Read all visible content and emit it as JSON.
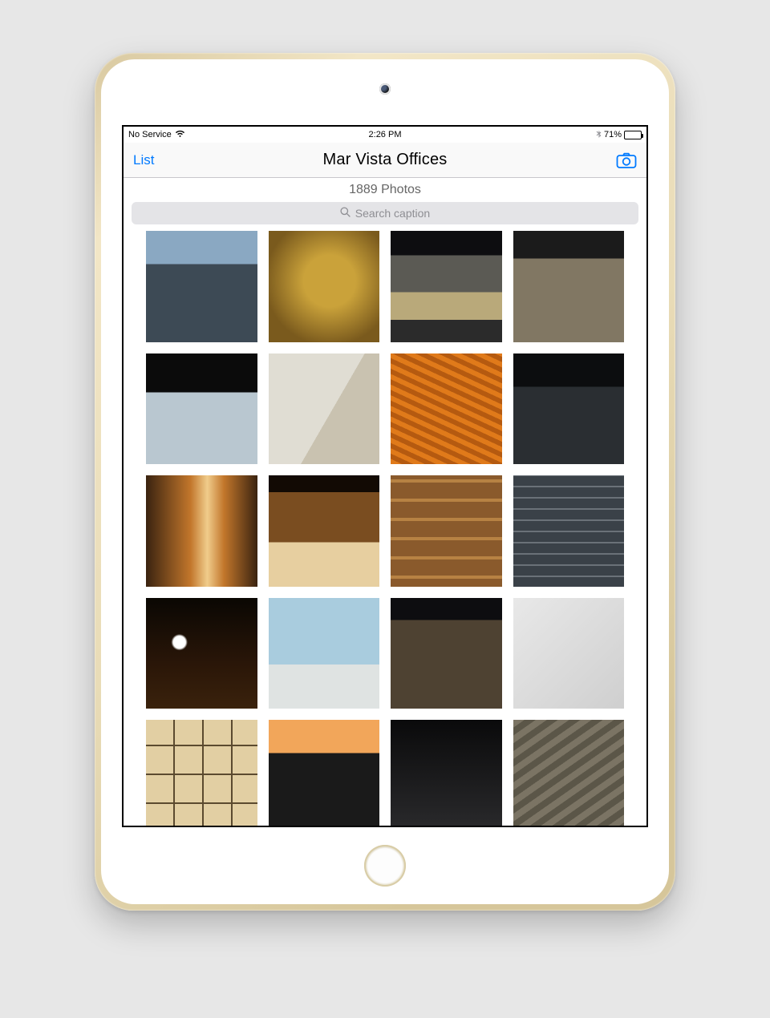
{
  "status": {
    "carrier": "No Service",
    "time": "2:26 PM",
    "battery_pct": "71%",
    "battery_fill_pct": 71
  },
  "nav": {
    "back_label": "List",
    "title": "Mar Vista Offices"
  },
  "subheader": {
    "count_label": "1889 Photos"
  },
  "search": {
    "placeholder": "Search caption"
  },
  "grid": {
    "thumbnails": [
      {
        "cls": "p1"
      },
      {
        "cls": "p2"
      },
      {
        "cls": "p3"
      },
      {
        "cls": "p4"
      },
      {
        "cls": "p5"
      },
      {
        "cls": "p6"
      },
      {
        "cls": "p7"
      },
      {
        "cls": "p8"
      },
      {
        "cls": "p9"
      },
      {
        "cls": "p10"
      },
      {
        "cls": "p11"
      },
      {
        "cls": "p12"
      },
      {
        "cls": "p13"
      },
      {
        "cls": "p14"
      },
      {
        "cls": "p15"
      },
      {
        "cls": "p16"
      },
      {
        "cls": "p17"
      },
      {
        "cls": "p18"
      },
      {
        "cls": "p19"
      },
      {
        "cls": "p20"
      },
      {
        "cls": "p21",
        "short": true
      },
      {
        "cls": "p22",
        "short": true
      },
      {
        "cls": "p23",
        "short": true
      },
      {
        "cls": "p24",
        "short": true
      }
    ]
  }
}
